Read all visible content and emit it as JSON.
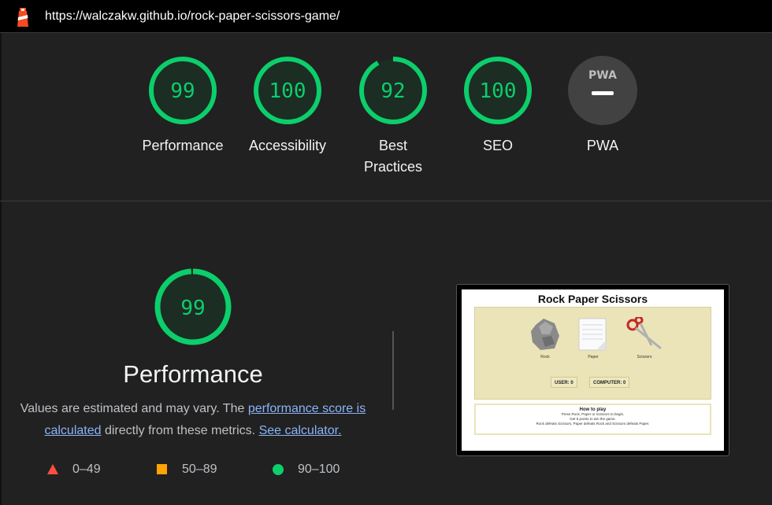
{
  "browser": {
    "url": "https://walczakw.github.io/rock-paper-scissors-game/"
  },
  "gauges": [
    {
      "score": "99",
      "label": "Performance"
    },
    {
      "score": "100",
      "label": "Accessibility"
    },
    {
      "score": "92",
      "label": "Best Practices"
    },
    {
      "score": "100",
      "label": "SEO"
    },
    {
      "score": "",
      "label": "PWA",
      "badge": "PWA"
    }
  ],
  "performance": {
    "score": "99",
    "title": "Performance",
    "description_prefix": "Values are estimated and may vary. The ",
    "link_score": "performance score is calculated",
    "description_mid": " directly from these metrics. ",
    "link_calculator": "See calculator."
  },
  "legend": [
    {
      "range": "0–49",
      "color": "#ff4e42",
      "shape": "triangle"
    },
    {
      "range": "50–89",
      "color": "#ffa400",
      "shape": "square"
    },
    {
      "range": "90–100",
      "color": "#0cce6b",
      "shape": "circle"
    }
  ],
  "colors": {
    "pass": "#0cce6b",
    "background": "#212121",
    "link": "#8ab4f8"
  },
  "screenshot": {
    "title": "Rock Paper Scissors",
    "choices": [
      "Rock",
      "Paper",
      "Scissors"
    ],
    "user_score": "USER: 0",
    "computer_score": "COMPUTER: 0",
    "how_title": "How to play",
    "how_lines": [
      "Press Rock, Paper or Scissors to begin.",
      "Get 5 points to win the game.",
      "Rock defeats Scissors, Paper defeats Rock and Scissors defeats Paper."
    ]
  }
}
